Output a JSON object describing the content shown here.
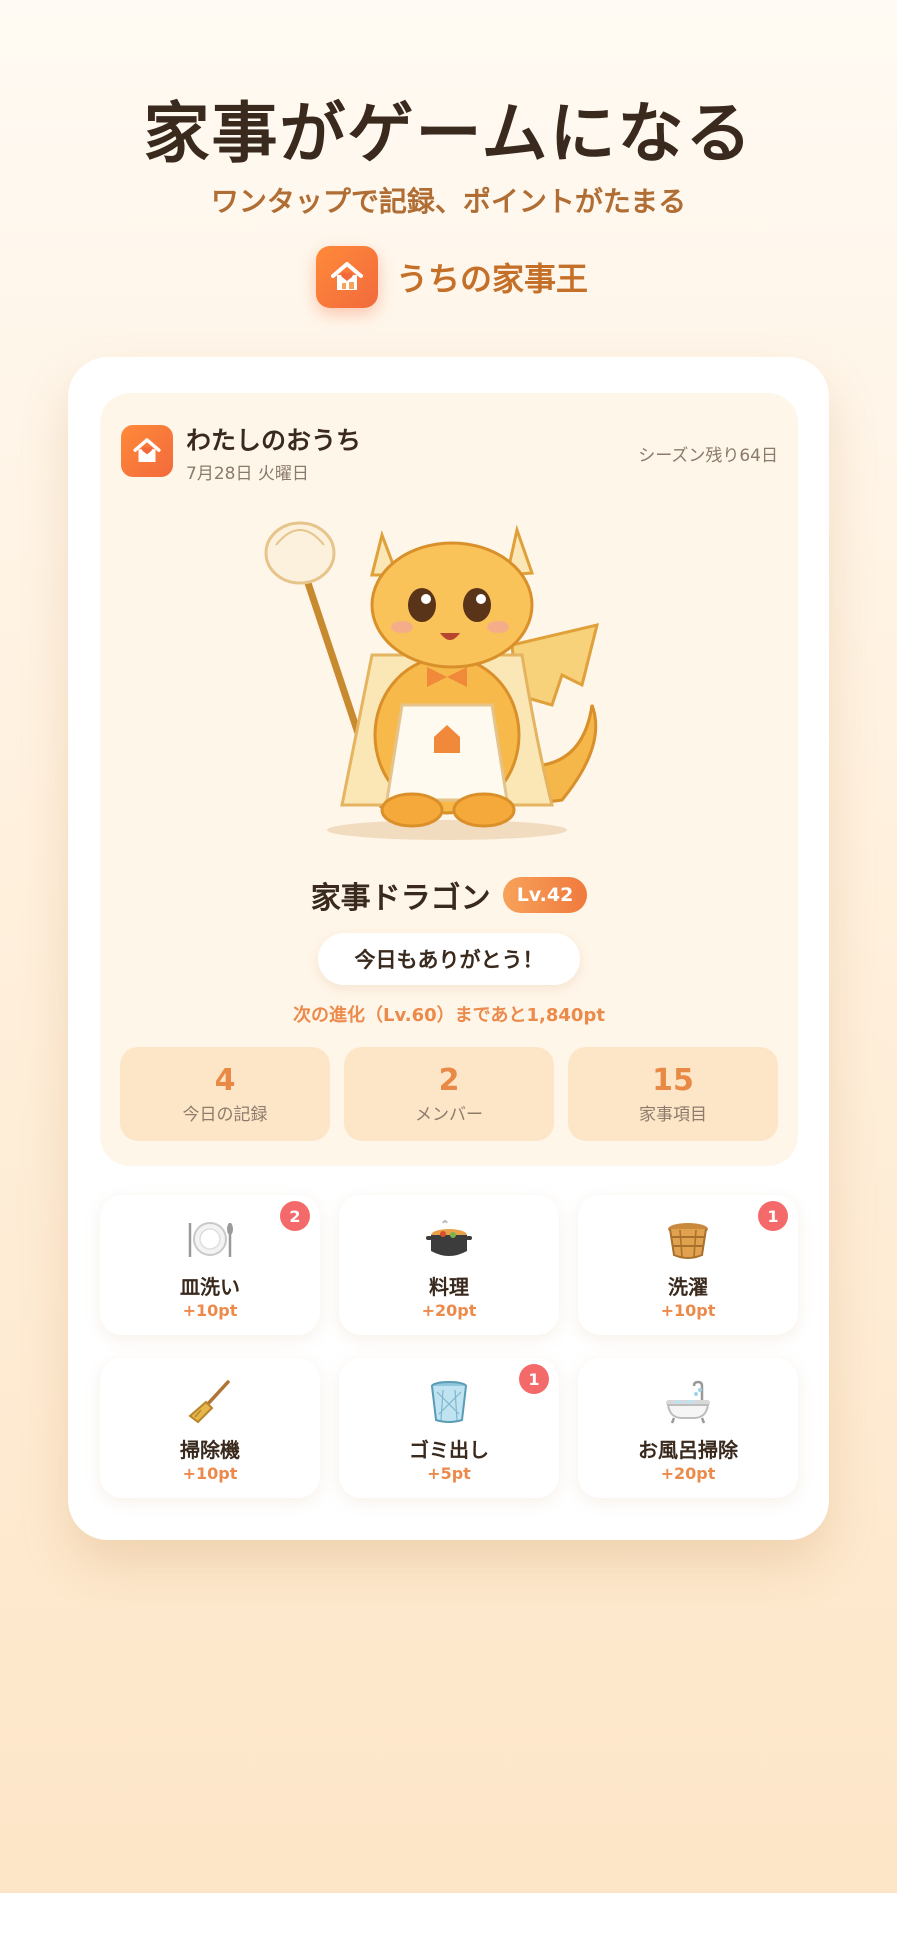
{
  "hero": {
    "headline": "家事がゲームになる",
    "subline": "ワンタップで記録、ポイントがたまる",
    "app_name": "うちの家事王",
    "app_icon": "house-heart-icon"
  },
  "header": {
    "house_name": "わたしのおうち",
    "date": "7月28日 火曜日",
    "season_remaining": "シーズン残り64日"
  },
  "character": {
    "name": "家事ドラゴン",
    "level": "Lv.42",
    "message": "今日もありがとう！",
    "next_evolution": "次の進化（Lv.60）まであと1,840pt"
  },
  "stats": [
    {
      "value": "4",
      "label": "今日の記録"
    },
    {
      "value": "2",
      "label": "メンバー"
    },
    {
      "value": "15",
      "label": "家事項目"
    }
  ],
  "chores": [
    {
      "name": "皿洗い",
      "points": "+10pt",
      "badge": "2",
      "icon": "plate-cutlery-icon"
    },
    {
      "name": "料理",
      "points": "+20pt",
      "badge": "",
      "icon": "pot-icon"
    },
    {
      "name": "洗濯",
      "points": "+10pt",
      "badge": "1",
      "icon": "laundry-basket-icon"
    },
    {
      "name": "掃除機",
      "points": "+10pt",
      "badge": "",
      "icon": "broom-icon"
    },
    {
      "name": "ゴミ出し",
      "points": "+5pt",
      "badge": "1",
      "icon": "trash-can-icon"
    },
    {
      "name": "お風呂掃除",
      "points": "+20pt",
      "badge": "",
      "icon": "bathtub-icon"
    }
  ],
  "colors": {
    "accent": "#f07a3e",
    "points": "#ec8a4b",
    "badge": "#f46a6a"
  }
}
